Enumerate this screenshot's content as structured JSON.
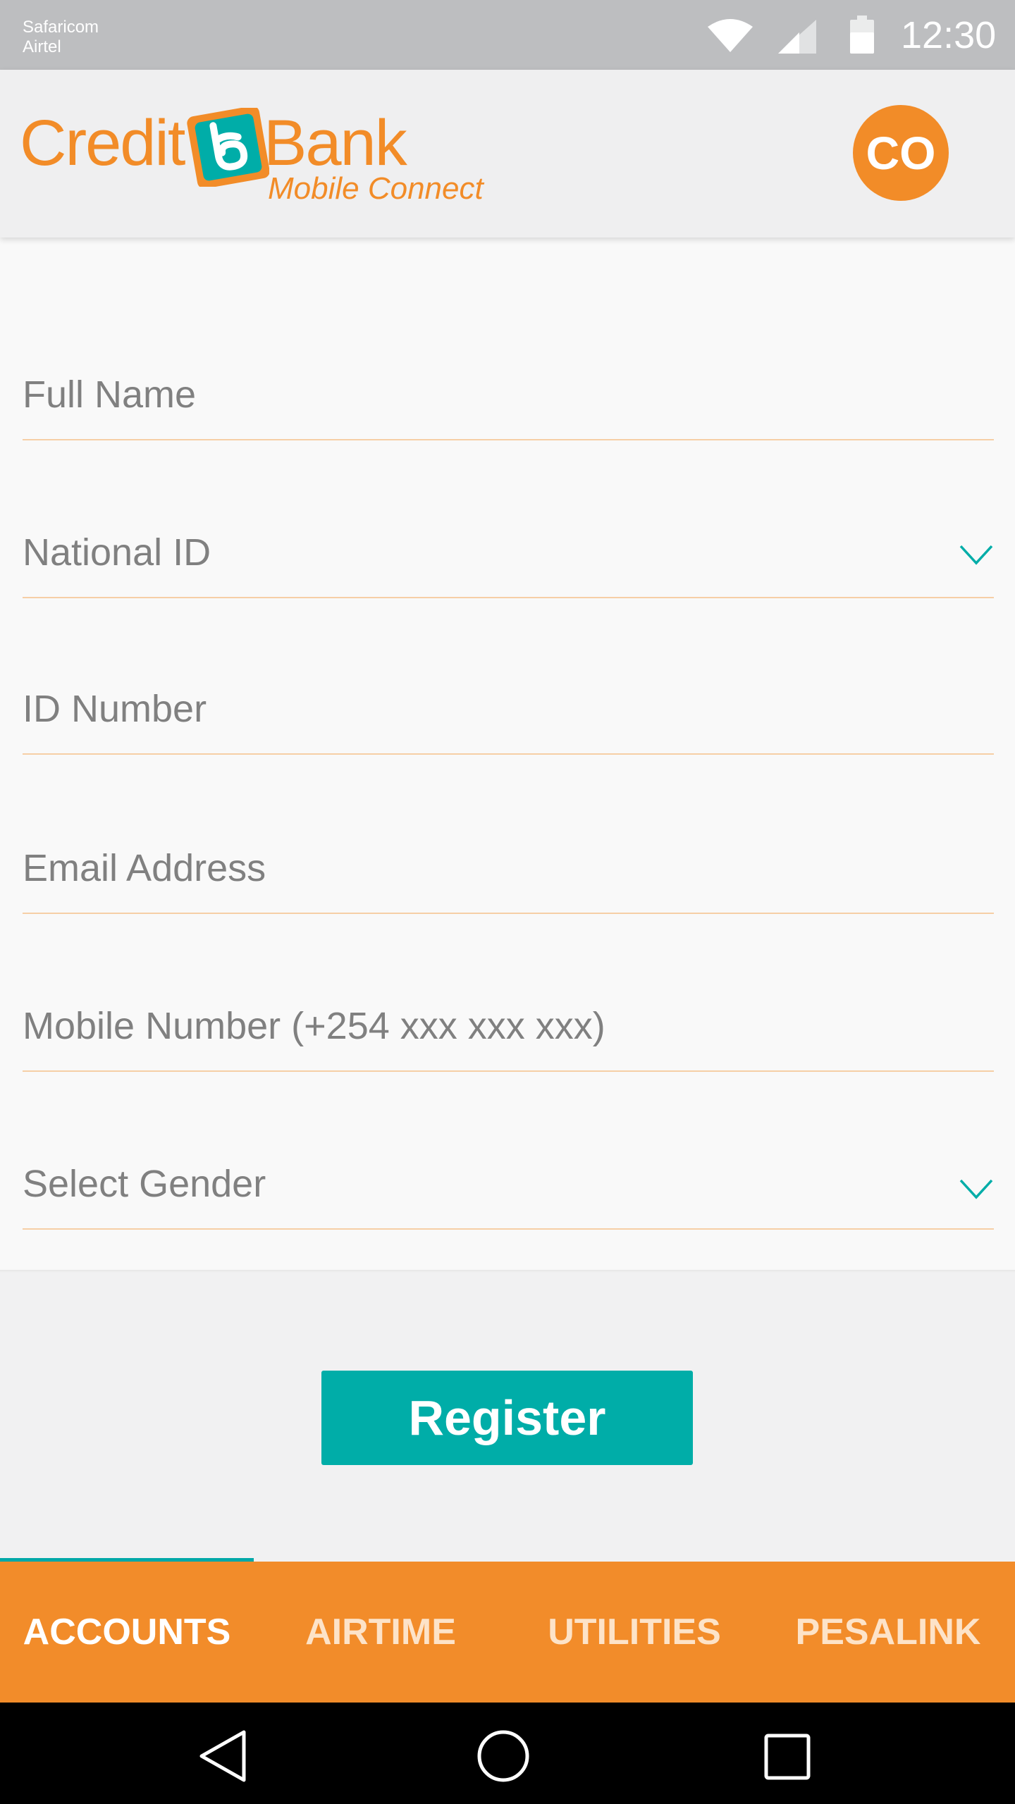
{
  "status_bar": {
    "carriers": [
      "Safaricom",
      "Airtel"
    ],
    "time": "12:30",
    "icons": [
      "wifi-icon",
      "signal-icon",
      "battery-icon"
    ]
  },
  "header": {
    "logo": {
      "word1": "Credit",
      "word2": "Bank",
      "tagline": "Mobile Connect"
    },
    "avatar_initials": "CO"
  },
  "form": {
    "fields": [
      {
        "placeholder": "Full Name",
        "type": "text"
      },
      {
        "placeholder": "National ID",
        "type": "select"
      },
      {
        "placeholder": "ID Number",
        "type": "text"
      },
      {
        "placeholder": "Email Address",
        "type": "text"
      },
      {
        "placeholder": "Mobile Number (+254 xxx xxx xxx)",
        "type": "text"
      },
      {
        "placeholder": "Select Gender",
        "type": "select"
      }
    ]
  },
  "actions": {
    "register_label": "Register"
  },
  "tabs": [
    {
      "label": "ACCOUNTS",
      "active": true
    },
    {
      "label": "AIRTIME",
      "active": false
    },
    {
      "label": "UTILITIES",
      "active": false
    },
    {
      "label": "PESALINK",
      "active": false
    }
  ],
  "colors": {
    "brand_orange": "#f28c28",
    "brand_teal": "#00ada8",
    "status_bar": "#bdbec0",
    "field_underline": "#f6cfa6"
  }
}
